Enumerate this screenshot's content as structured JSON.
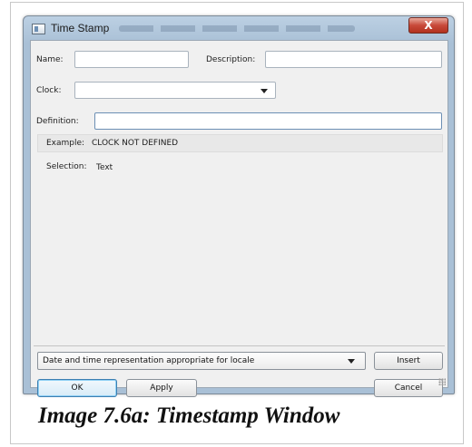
{
  "window": {
    "title": "Time Stamp",
    "close_glyph": "X"
  },
  "form": {
    "name_label": "Name:",
    "name_value": "",
    "description_label": "Description:",
    "description_value": "",
    "clock_label": "Clock:",
    "clock_value": "",
    "definition_label": "Definition:",
    "definition_value": "",
    "example_label": "Example:",
    "example_value": "CLOCK NOT DEFINED",
    "selection_label": "Selection:",
    "selection_value": "Text"
  },
  "format_combo": {
    "selected": "Date and time representation appropriate for locale"
  },
  "buttons": {
    "insert": "Insert",
    "ok": "OK",
    "apply": "Apply",
    "cancel": "Cancel"
  },
  "caption": "Image 7.6a: Timestamp Window",
  "icons": [
    "window-icon",
    "close-icon",
    "dropdown-arrow-icon",
    "resize-grip-icon"
  ]
}
